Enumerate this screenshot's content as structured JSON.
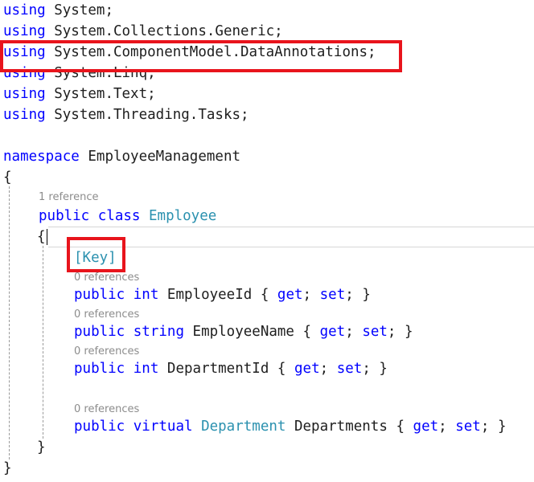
{
  "code": {
    "using_kw": "using",
    "usings": [
      "System;",
      "System.Collections.Generic;",
      "System.ComponentModel.DataAnnotations;",
      "System.Linq;",
      "System.Text;",
      "System.Threading.Tasks;"
    ],
    "namespace_kw": "namespace",
    "namespace_name": "EmployeeManagement",
    "open_brace": "{",
    "close_brace": "}",
    "class_refs": "1 reference",
    "public_kw": "public",
    "class_kw": "class",
    "class_name": "Employee",
    "key_attr": "[Key]",
    "props": [
      {
        "refs": "0 references",
        "modifier": "",
        "type_kw": "int",
        "type_name": "",
        "name": "EmployeeId"
      },
      {
        "refs": "0 references",
        "modifier": "",
        "type_kw": "string",
        "type_name": "",
        "name": "EmployeeName"
      },
      {
        "refs": "0 references",
        "modifier": "",
        "type_kw": "int",
        "type_name": "",
        "name": "DepartmentId"
      },
      {
        "refs": "0 references",
        "modifier": "virtual",
        "type_kw": "",
        "type_name": "Department",
        "name": "Departments"
      }
    ],
    "accessor_open": "{",
    "get_kw": "get",
    "set_kw": "set",
    "semicolon": ";",
    "accessor_close": "}"
  },
  "colors": {
    "keyword": "#0000ff",
    "type": "#2b91af",
    "text": "#1e1e1e",
    "codelens": "#8c8c8c",
    "callout": "#e8141c"
  }
}
